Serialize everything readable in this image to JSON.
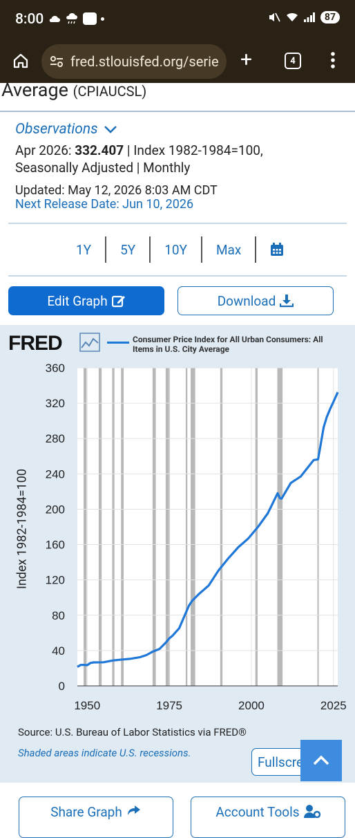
{
  "status": {
    "time": "8:00",
    "battery": "87"
  },
  "browser": {
    "url": "fred.stlouisfed.org/serie",
    "tab_count": "4"
  },
  "header": {
    "title": "Average",
    "series_id": "(CPIAUCSL)"
  },
  "observations": {
    "toggle_label": "Observations",
    "date": "Apr 2026:",
    "value": "332.407",
    "units": "| Index 1982-1984=100,",
    "adjustment": "Seasonally Adjusted | Monthly",
    "updated": "Updated: May 12, 2026 8:03 AM CDT",
    "next_release": "Next Release Date: Jun 10, 2026"
  },
  "ranges": [
    "1Y",
    "5Y",
    "10Y",
    "Max"
  ],
  "actions": {
    "edit_graph": "Edit Graph",
    "download": "Download",
    "fullscreen": "Fullscreen",
    "share_graph": "Share Graph",
    "account_tools": "Account Tools"
  },
  "graph": {
    "logo": "FRED",
    "source": "Source: U.S. Bureau of Labor Statistics via FRED®",
    "recession_note": "Shaded areas indicate U.S. recessions.",
    "colors": {
      "line": "#1f77d8",
      "recession": "#b8b8b8",
      "background": "#e0eaf3"
    }
  },
  "chart_data": {
    "type": "line",
    "title": "",
    "xlabel": "",
    "ylabel": "Index 1982-1984=100",
    "ylim": [
      0,
      360
    ],
    "xlim": [
      1947,
      2026.3
    ],
    "yticks": [
      0,
      40,
      80,
      120,
      160,
      200,
      240,
      280,
      320,
      360
    ],
    "xticks": [
      1950,
      1975,
      2000,
      2025
    ],
    "grid": true,
    "legend_position": "top",
    "series": [
      {
        "name": "Consumer Price Index for All Urban Consumers: All Items in U.S. City Average",
        "x": [
          1947,
          1948,
          1949,
          1950,
          1951,
          1952,
          1955,
          1958,
          1960,
          1963,
          1966,
          1968,
          1970,
          1972,
          1974,
          1975,
          1976,
          1978,
          1980,
          1981,
          1982,
          1984,
          1987,
          1990,
          1993,
          1996,
          1999,
          2002,
          2005,
          2008,
          2008.7,
          2009.2,
          2012,
          2015,
          2019,
          2020.3,
          2021,
          2022,
          2023,
          2024,
          2025,
          2026.3
        ],
        "y": [
          21.5,
          23.7,
          23.8,
          23.5,
          26.0,
          26.6,
          26.8,
          28.9,
          29.6,
          30.6,
          32.4,
          34.8,
          38.8,
          41.8,
          49.3,
          53.8,
          56.9,
          65.2,
          82.4,
          90.9,
          96.5,
          103.9,
          113.6,
          130.7,
          144.5,
          156.9,
          166.6,
          179.9,
          195.3,
          218.1,
          212.4,
          211.9,
          229.6,
          237.0,
          255.7,
          256.4,
          270.9,
          292.7,
          304.7,
          313.7,
          321.5,
          332.4
        ]
      }
    ],
    "recessions": [
      [
        1948.9,
        1949.8
      ],
      [
        1953.5,
        1954.4
      ],
      [
        1957.6,
        1958.3
      ],
      [
        1960.3,
        1961.1
      ],
      [
        1969.9,
        1970.9
      ],
      [
        1973.9,
        1975.2
      ],
      [
        1980.0,
        1980.5
      ],
      [
        1981.5,
        1982.9
      ],
      [
        1990.5,
        1991.2
      ],
      [
        2001.2,
        2001.9
      ],
      [
        2007.9,
        2009.5
      ],
      [
        2020.1,
        2020.3
      ]
    ]
  }
}
